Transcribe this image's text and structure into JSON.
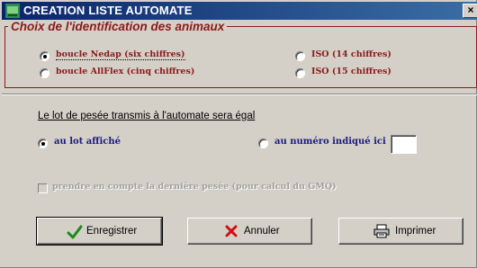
{
  "window": {
    "title": "CREATION LISTE AUTOMATE",
    "close": "×"
  },
  "identification": {
    "legend": "Choix de l'identification des animaux",
    "options": [
      {
        "label": "boucle Nedap (six chiffres)",
        "checked": true
      },
      {
        "label": "boucle AllFlex (cinq chiffres)",
        "checked": false
      },
      {
        "label": "ISO (14 chiffres)",
        "checked": false
      },
      {
        "label": "ISO (15 chiffres)",
        "checked": false
      }
    ]
  },
  "lot": {
    "heading": "Le lot de pesée transmis à l'automate sera égal",
    "options": [
      {
        "label": "au lot affiché",
        "checked": true
      },
      {
        "label": "au numéro indiqué ici",
        "checked": false
      }
    ],
    "number_value": ""
  },
  "gmq_checkbox": {
    "label": "prendre en compte  la dernière pesée (pour calcul du GMQ)",
    "checked": false,
    "enabled": false
  },
  "buttons": {
    "save": {
      "label": "Enregistrer",
      "icon": "checkmark-icon"
    },
    "cancel": {
      "label": "Annuler",
      "icon": "red-x-icon"
    },
    "print": {
      "label": "Imprimer",
      "icon": "printer-icon"
    }
  },
  "colors": {
    "legend": "#8b1a1a",
    "lot_options": "#1a1a80",
    "titlebar": "#0a246a"
  }
}
